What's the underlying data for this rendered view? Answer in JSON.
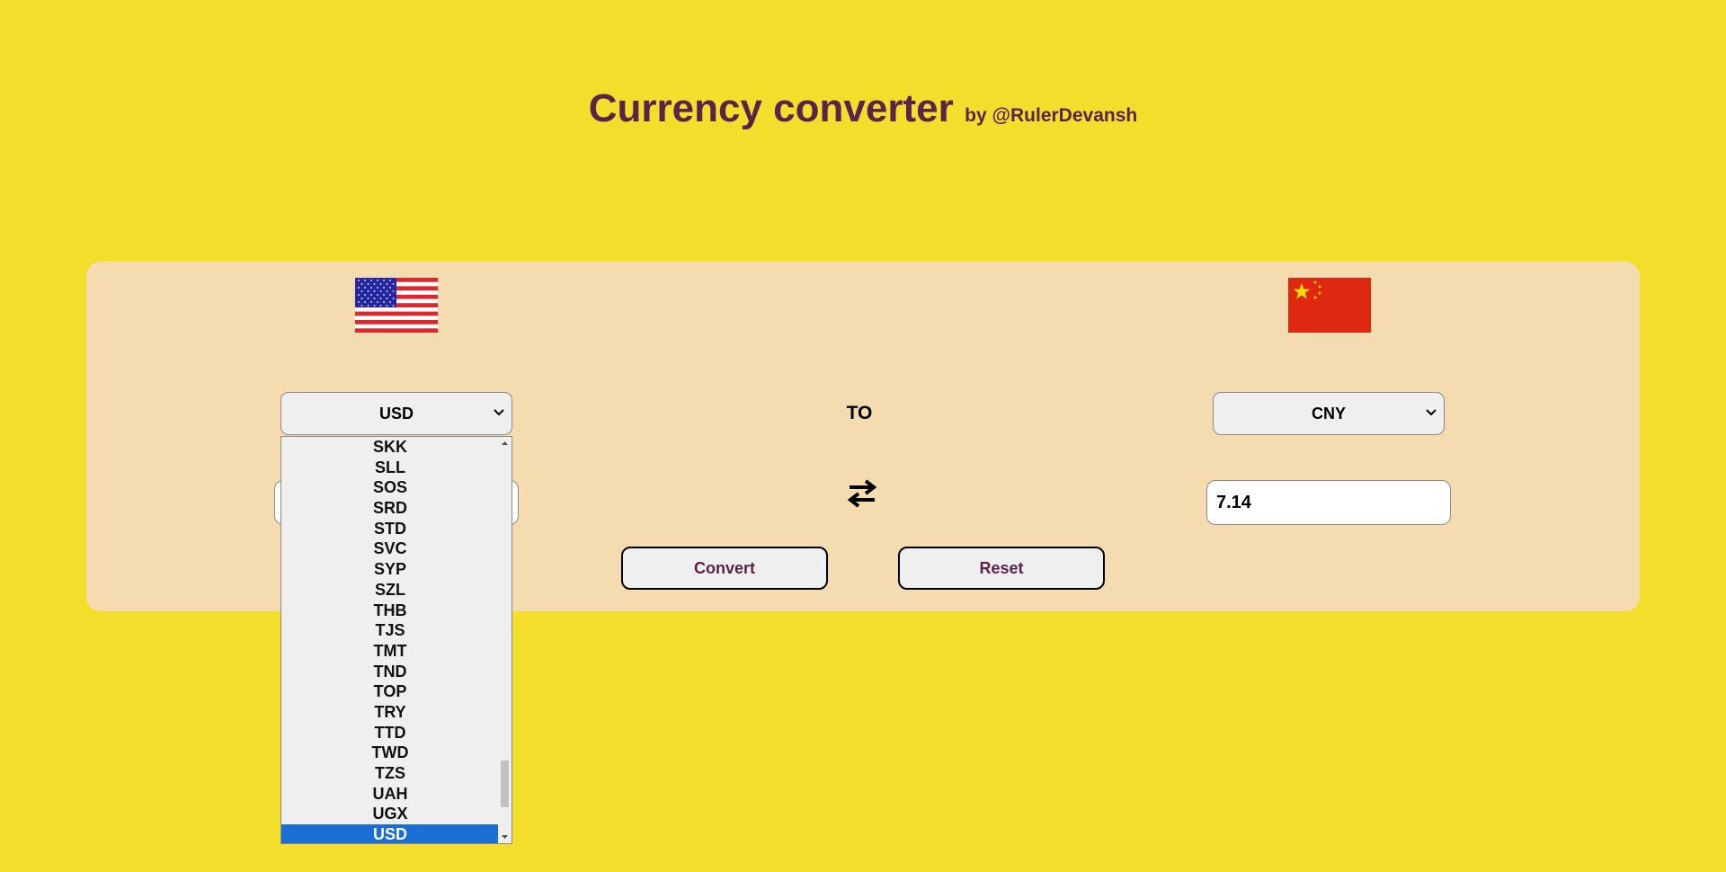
{
  "header": {
    "title": "Currency converter",
    "byline": "by @RulerDevansh"
  },
  "converter": {
    "from_currency": "USD",
    "to_currency": "CNY",
    "to_label": "TO",
    "from_amount": "",
    "to_amount": "7.14",
    "convert_label": "Convert",
    "reset_label": "Reset",
    "from_flag": "us-flag-icon",
    "to_flag": "cn-flag-icon",
    "swap_icon": "swap-arrows-icon"
  },
  "dropdown": {
    "options": [
      "SKK",
      "SLL",
      "SOS",
      "SRD",
      "STD",
      "SVC",
      "SYP",
      "SZL",
      "THB",
      "TJS",
      "TMT",
      "TND",
      "TOP",
      "TRY",
      "TTD",
      "TWD",
      "TZS",
      "UAH",
      "UGX",
      "USD"
    ],
    "selected": "USD"
  },
  "colors": {
    "background": "#f3df2b",
    "panel": "#f4dcb0",
    "accent_text": "#5b2347",
    "selection": "#1a6ed4"
  }
}
